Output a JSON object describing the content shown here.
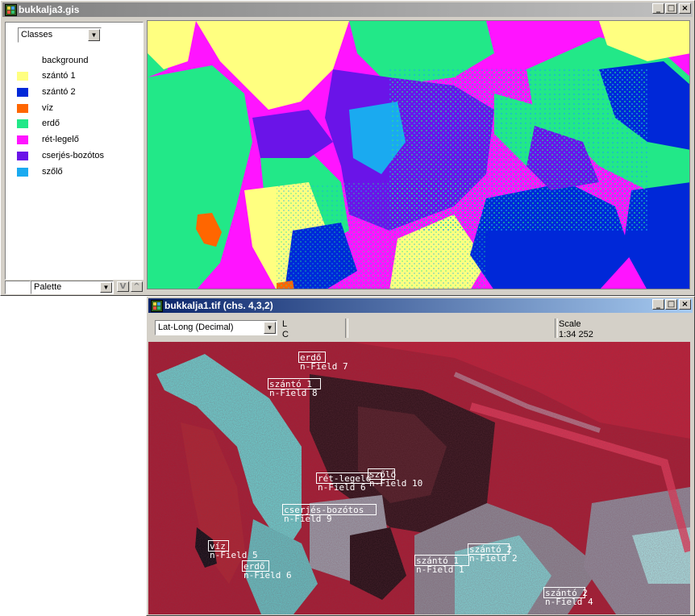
{
  "window_top": {
    "title": "bukkalja3.gis",
    "panel_select": "Classes",
    "legend": [
      {
        "label": "background",
        "color": "#ffffff"
      },
      {
        "label": "szántó 1",
        "color": "#ffff80"
      },
      {
        "label": "szántó 2",
        "color": "#0028d8"
      },
      {
        "label": "víz",
        "color": "#ff6600"
      },
      {
        "label": "erdő",
        "color": "#22e888"
      },
      {
        "label": "rét-legelő",
        "color": "#ff14ff"
      },
      {
        "label": "cserjés-bozótos",
        "color": "#6a14e8"
      },
      {
        "label": "szőlő",
        "color": "#1aaaf0"
      }
    ],
    "palette_select": "Palette",
    "palette_btn1": "V",
    "palette_btn2": "^"
  },
  "window_bottom": {
    "title": "bukkalja1.tif (chs. 4,3,2)",
    "coord_select": "Lat-Long (Decimal)",
    "status_l": "L",
    "status_c": "C",
    "scale_label": "Scale",
    "scale_value": "1:34 252",
    "field_labels": [
      {
        "cls": "erdő",
        "field": "n-Field 7"
      },
      {
        "cls": "szántó 1",
        "field": "n-Field 8"
      },
      {
        "cls": "rét-legelő",
        "field": "n-Field 6"
      },
      {
        "cls": "szőlő",
        "field": "n-Field 10"
      },
      {
        "cls": "cserjés-bozótos",
        "field": "n-Field 9"
      },
      {
        "cls": "víz",
        "field": "n-Field 5"
      },
      {
        "cls": "erdő",
        "field": "n-Field 6"
      },
      {
        "cls": "szántó 1",
        "field": "n-Field 1"
      },
      {
        "cls": "szántó 2",
        "field": "n-Field 2"
      },
      {
        "cls": "szántó 2",
        "field": "n-Field 4"
      }
    ]
  },
  "window_buttons": {
    "minimize": "_",
    "maximize": "□",
    "close": "×"
  }
}
